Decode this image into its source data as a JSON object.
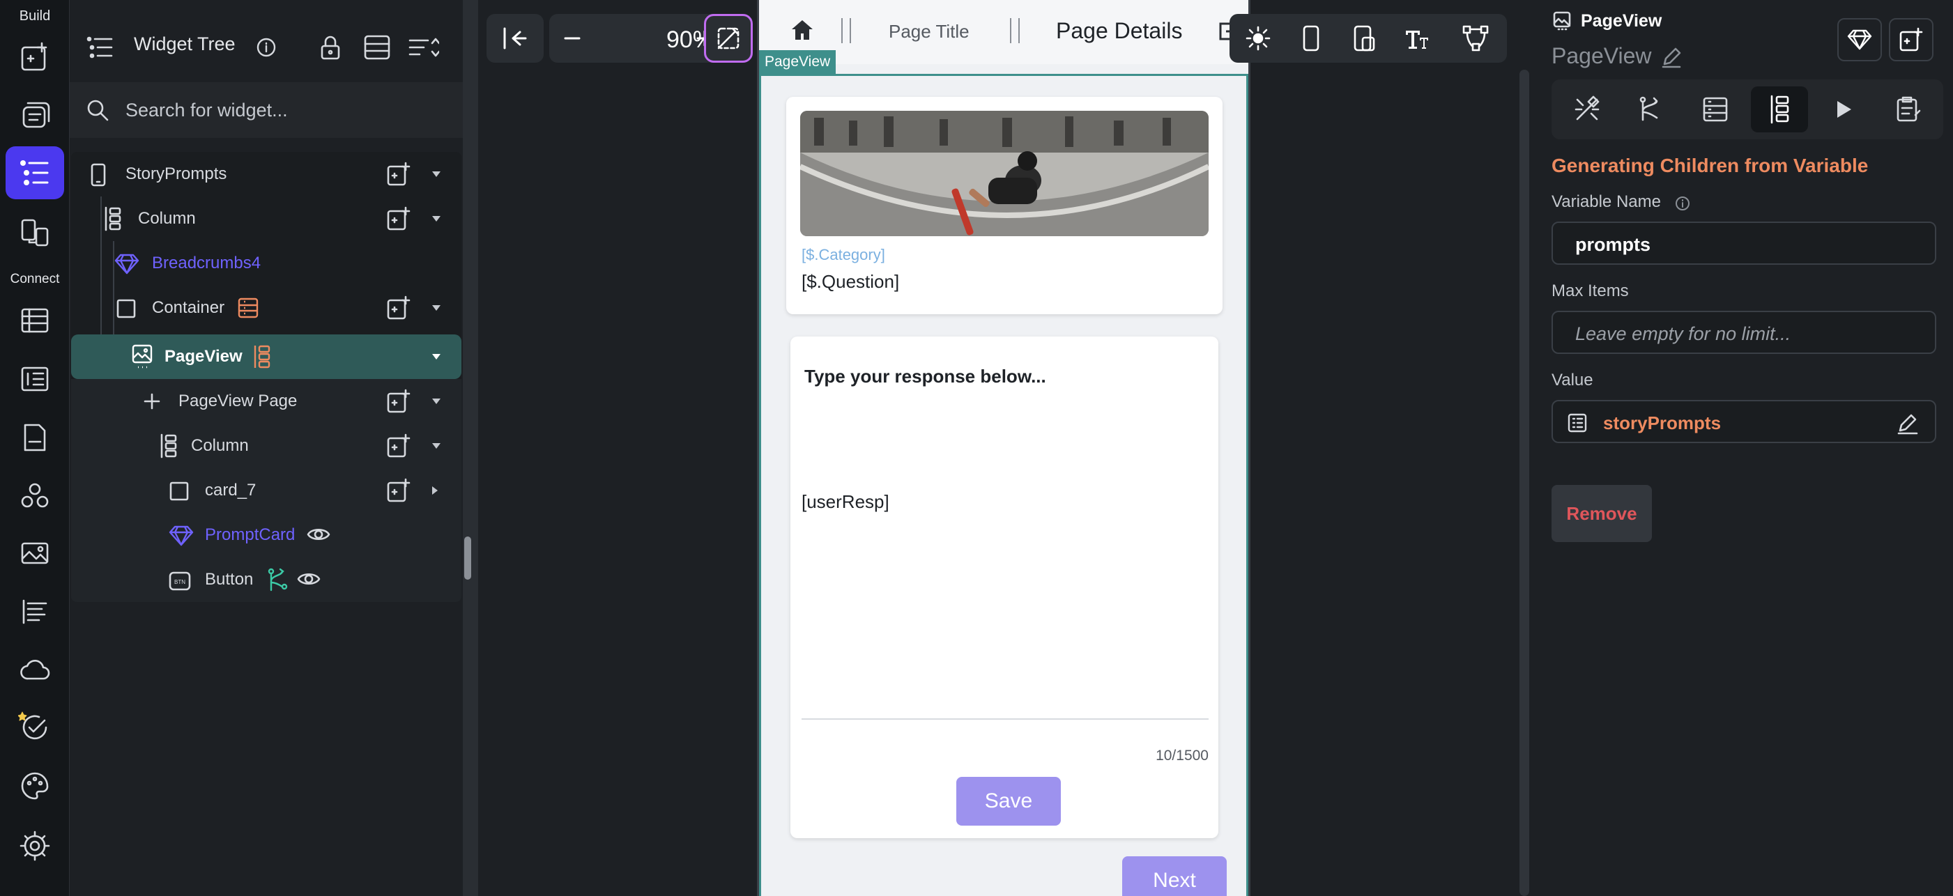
{
  "rail": {
    "section_build": "Build",
    "section_connect": "Connect",
    "build_items": [
      "add-widget-icon",
      "page-selector-icon",
      "widget-tree-icon",
      "storyboard-icon"
    ],
    "connect_items": [
      "firestore-icon",
      "app-state-icon",
      "api-calls-icon",
      "custom-code-icon",
      "media-assets-icon",
      "app-values-icon",
      "cloud-functions-icon",
      "tests-icon",
      "theme-icon",
      "settings-icon"
    ]
  },
  "widget_tree": {
    "title": "Widget Tree",
    "search_placeholder": "Search for widget...",
    "items": [
      {
        "label": "StoryPrompts"
      },
      {
        "label": "Column"
      },
      {
        "label": "Breadcrumbs4"
      },
      {
        "label": "Container"
      },
      {
        "label": "PageView"
      },
      {
        "label": "PageView Page"
      },
      {
        "label": "Column"
      },
      {
        "label": "card_7"
      },
      {
        "label": "PromptCard"
      },
      {
        "label": "Button"
      }
    ]
  },
  "canvas": {
    "zoom": "90%",
    "appbar": {
      "page_title": "Page Title",
      "page_details": "Page Details"
    },
    "pageview_tag": "PageView",
    "prompt_card": {
      "category": "[$.Category]",
      "question": "[$.Question]"
    },
    "response_card": {
      "label": "Type your response below...",
      "value": "[userResp]",
      "counter": "10/1500",
      "save_label": "Save"
    },
    "next_label": "Next"
  },
  "properties": {
    "widget_type": "PageView",
    "widget_name": "PageView",
    "section_title": "Generating Children from Variable",
    "variable_name_label": "Variable Name",
    "variable_name_value": "prompts",
    "max_items_label": "Max Items",
    "max_items_placeholder": "Leave empty for no limit...",
    "value_label": "Value",
    "value_value": "storyPrompts",
    "remove_label": "Remove"
  },
  "colors": {
    "accent": "#4b39ef",
    "selected_row": "#2f5a58",
    "orange": "#ee8b60",
    "pageview_teal": "#3e8f8b",
    "button_purple": "#9d92ee",
    "remove_red": "#e0565b"
  }
}
